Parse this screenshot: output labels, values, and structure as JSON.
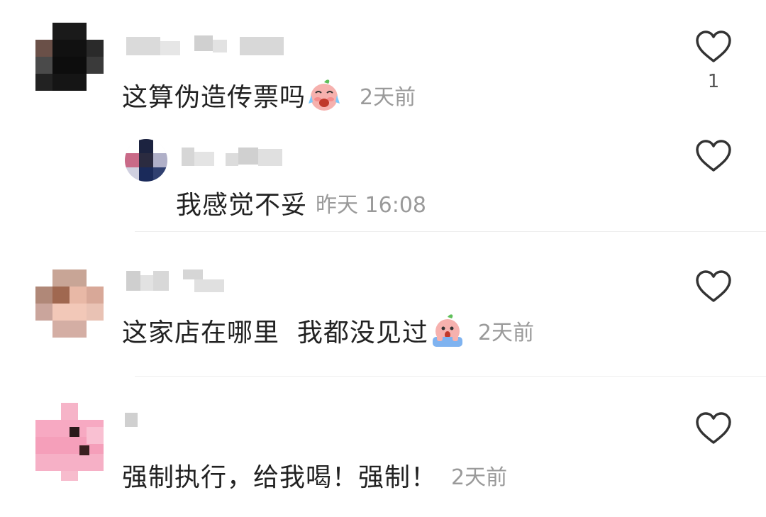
{
  "comments": [
    {
      "text": "这算伪造传票吗",
      "emoji": "crying-face-emoji",
      "time": "2天前",
      "likes": "1",
      "replies": [
        {
          "text": "我感觉不妥",
          "time": "昨天 16:08"
        }
      ]
    },
    {
      "text": "这家店在哪里  我都没见过",
      "emoji": "shocked-face-emoji",
      "time": "2天前"
    },
    {
      "text": "强制执行，给我喝！强制！",
      "time": "2天前"
    }
  ],
  "icons": {
    "like": "heart-outline-icon"
  },
  "colors": {
    "text": "#222222",
    "meta": "#9a9a9a",
    "divider": "#eeeeee"
  }
}
